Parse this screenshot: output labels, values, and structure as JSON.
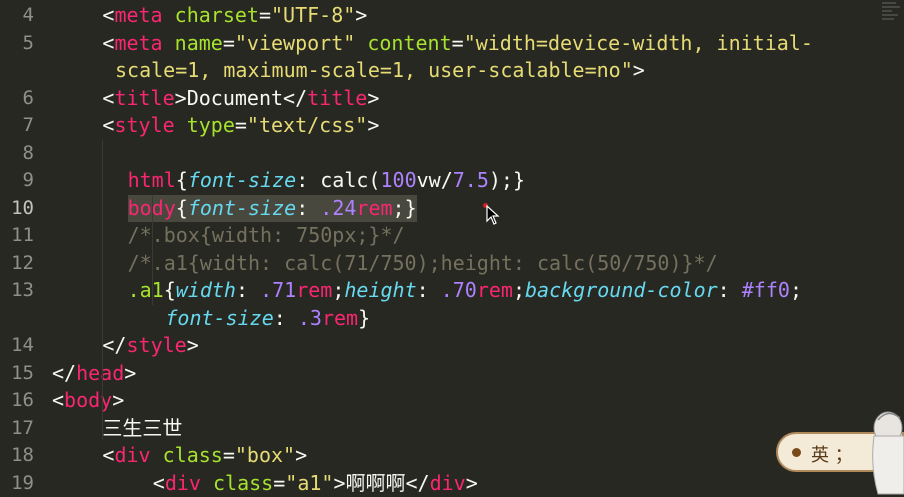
{
  "editor": {
    "active_line": "10",
    "lines": [
      {
        "n": "4",
        "segments": [
          [
            "t-plain",
            "<"
          ],
          [
            "t-tag",
            "meta"
          ],
          [
            "t-plain",
            " "
          ],
          [
            "t-attr",
            "charset"
          ],
          [
            "t-plain",
            "="
          ],
          [
            "t-str",
            "\"UTF-8\""
          ],
          [
            "t-plain",
            ">"
          ]
        ]
      },
      {
        "n": "5",
        "segments": [
          [
            "t-plain",
            "<"
          ],
          [
            "t-tag",
            "meta"
          ],
          [
            "t-plain",
            " "
          ],
          [
            "t-attr",
            "name"
          ],
          [
            "t-plain",
            "="
          ],
          [
            "t-str",
            "\"viewport\""
          ],
          [
            "t-plain",
            " "
          ],
          [
            "t-attr",
            "content"
          ],
          [
            "t-plain",
            "="
          ],
          [
            "t-str",
            "\"width=device-width, initial-"
          ]
        ]
      },
      {
        "n": "",
        "segments": [
          [
            "t-str",
            "scale=1, maximum-scale=1, user-scalable=no\""
          ],
          [
            "t-plain",
            ">"
          ]
        ]
      },
      {
        "n": "6",
        "segments": [
          [
            "t-plain",
            "<"
          ],
          [
            "t-tag",
            "title"
          ],
          [
            "t-plain",
            ">Document</"
          ],
          [
            "t-tag",
            "title"
          ],
          [
            "t-plain",
            ">"
          ]
        ]
      },
      {
        "n": "7",
        "segments": [
          [
            "t-plain",
            "<"
          ],
          [
            "t-tag",
            "style"
          ],
          [
            "t-plain",
            " "
          ],
          [
            "t-attr",
            "type"
          ],
          [
            "t-plain",
            "="
          ],
          [
            "t-str",
            "\"text/css\""
          ],
          [
            "t-plain",
            ">"
          ]
        ]
      },
      {
        "n": "8",
        "segments": []
      },
      {
        "n": "9",
        "segments": [
          [
            "t-tag",
            "html"
          ],
          [
            "t-plain",
            "{"
          ],
          [
            "t-prop",
            "font-size"
          ],
          [
            "t-plain",
            ": calc("
          ],
          [
            "t-num",
            "100"
          ],
          [
            "t-plain",
            "vw/"
          ],
          [
            "t-num",
            "7.5"
          ],
          [
            "t-plain",
            ");}"
          ]
        ]
      },
      {
        "n": "10",
        "segments": [
          [
            "t-tag",
            "body"
          ],
          [
            "t-plain",
            "{"
          ],
          [
            "t-prop",
            "font-size"
          ],
          [
            "t-plain",
            ": "
          ],
          [
            "t-num",
            ".24"
          ],
          [
            "t-unit",
            "rem"
          ],
          [
            "t-plain",
            ";}"
          ]
        ]
      },
      {
        "n": "11",
        "segments": [
          [
            "t-comment",
            "/*.box{width: 750px;}*/"
          ]
        ]
      },
      {
        "n": "12",
        "segments": [
          [
            "t-comment",
            "/*.a1{width: calc(71/750);height: calc(50/750)}*/"
          ]
        ]
      },
      {
        "n": "13",
        "segments": [
          [
            "t-sel",
            ".a1"
          ],
          [
            "t-plain",
            "{"
          ],
          [
            "t-prop",
            "width"
          ],
          [
            "t-plain",
            ": "
          ],
          [
            "t-num",
            ".71"
          ],
          [
            "t-unit",
            "rem"
          ],
          [
            "t-plain",
            ";"
          ],
          [
            "t-prop",
            "height"
          ],
          [
            "t-plain",
            ": "
          ],
          [
            "t-num",
            ".70"
          ],
          [
            "t-unit",
            "rem"
          ],
          [
            "t-plain",
            ";"
          ],
          [
            "t-prop",
            "background-color"
          ],
          [
            "t-plain",
            ": "
          ],
          [
            "t-num",
            "#ff0"
          ],
          [
            "t-plain",
            ";"
          ]
        ]
      },
      {
        "n": "",
        "segments": [
          [
            "t-prop",
            "font-size"
          ],
          [
            "t-plain",
            ": "
          ],
          [
            "t-num",
            ".3"
          ],
          [
            "t-unit",
            "rem"
          ],
          [
            "t-plain",
            "}"
          ]
        ]
      },
      {
        "n": "14",
        "segments": [
          [
            "t-plain",
            "</"
          ],
          [
            "t-tag",
            "style"
          ],
          [
            "t-plain",
            ">"
          ]
        ]
      },
      {
        "n": "15",
        "segments": [
          [
            "t-plain",
            "</"
          ],
          [
            "t-tag",
            "head"
          ],
          [
            "t-plain",
            ">"
          ]
        ]
      },
      {
        "n": "16",
        "segments": [
          [
            "t-plain",
            "<"
          ],
          [
            "t-tag",
            "body"
          ],
          [
            "t-plain",
            ">"
          ]
        ]
      },
      {
        "n": "17",
        "segments": [
          [
            "t-plain",
            "三生三世"
          ]
        ]
      },
      {
        "n": "18",
        "segments": [
          [
            "t-plain",
            "<"
          ],
          [
            "t-tag",
            "div"
          ],
          [
            "t-plain",
            " "
          ],
          [
            "t-attr",
            "class"
          ],
          [
            "t-plain",
            "="
          ],
          [
            "t-str",
            "\"box\""
          ],
          [
            "t-plain",
            ">"
          ]
        ]
      },
      {
        "n": "19",
        "segments": [
          [
            "t-plain",
            "<"
          ],
          [
            "t-tag",
            "div"
          ],
          [
            "t-plain",
            " "
          ],
          [
            "t-attr",
            "class"
          ],
          [
            "t-plain",
            "="
          ],
          [
            "t-str",
            "\"a1\""
          ],
          [
            "t-plain",
            ">啊啊啊</"
          ],
          [
            "t-tag",
            "div"
          ],
          [
            "t-plain",
            ">"
          ]
        ]
      }
    ]
  },
  "ime": {
    "mode_label": "英",
    "punct_label": "；"
  },
  "colors": {
    "background": "#272822",
    "tag": "#f92672",
    "attribute": "#a6e22e",
    "string": "#e6db74",
    "property": "#66d9ef",
    "number": "#ae81ff",
    "comment": "#75715e"
  }
}
